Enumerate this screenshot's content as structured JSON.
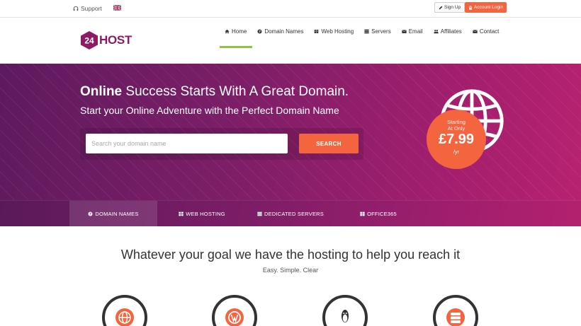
{
  "topbar": {
    "support_label": "Support",
    "signup_label": "Sign Up",
    "login_label": "Account Login"
  },
  "logo": {
    "number": "24",
    "text": "HOST"
  },
  "nav": [
    {
      "label": "Home",
      "icon": "home-icon"
    },
    {
      "label": "Domain Names",
      "icon": "globe-icon"
    },
    {
      "label": "Web Hosting",
      "icon": "book-icon"
    },
    {
      "label": "Servers",
      "icon": "servers-icon"
    },
    {
      "label": "Email",
      "icon": "envelope-icon"
    },
    {
      "label": "Affiliates",
      "icon": "users-icon"
    },
    {
      "label": "Contact",
      "icon": "envelope-icon"
    }
  ],
  "hero": {
    "title_bold": "Online",
    "title_rest": " Success Starts With A Great Domain.",
    "subtitle": "Start your Online Adventure with the Perfect Domain Name",
    "search_placeholder": "Search your domain name",
    "search_button": "SEARCH",
    "price_starting": "Starting",
    "price_at_only": "At Only",
    "price_value": "£7.99",
    "price_per": "/yr"
  },
  "tabs": [
    {
      "label": "DOMAIN NAMES",
      "icon": "globe-icon",
      "active": true
    },
    {
      "label": "WEB HOSTING",
      "icon": "grid-icon",
      "active": false
    },
    {
      "label": "DEDICATED SERVERS",
      "icon": "servers-icon",
      "active": false
    },
    {
      "label": "OFFICE365",
      "icon": "windows-icon",
      "active": false
    }
  ],
  "section": {
    "title": "Whatever your goal we have the hosting to help you reach it",
    "subtitle": "Easy. Simple. Clear"
  },
  "colors": {
    "accent": "#f4643f",
    "brand": "#8e1a63",
    "nav_active": "#8cc63f"
  }
}
